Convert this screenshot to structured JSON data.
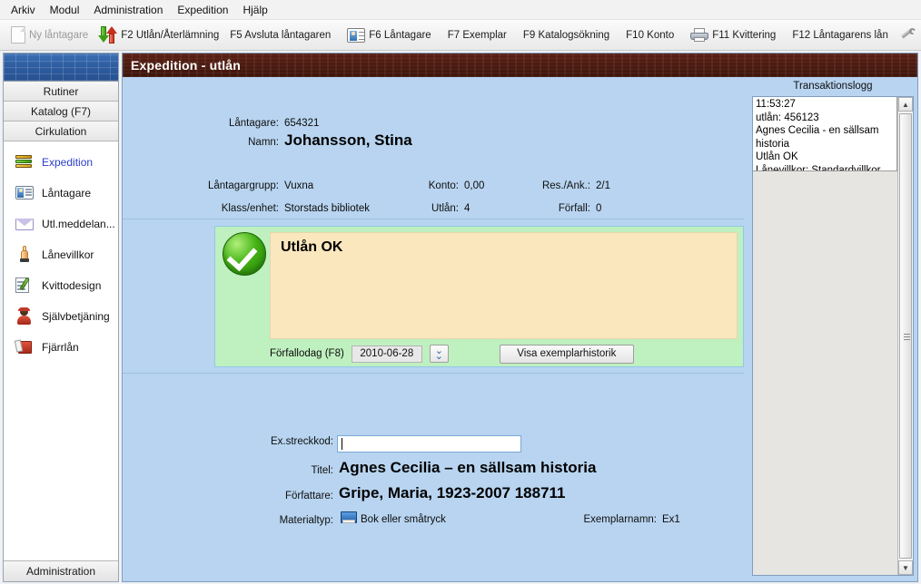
{
  "menubar": {
    "items": [
      {
        "label": "Arkiv"
      },
      {
        "label": "Modul"
      },
      {
        "label": "Administration"
      },
      {
        "label": "Expedition"
      },
      {
        "label": "Hjälp"
      }
    ]
  },
  "toolbar": {
    "new_borrower": "Ny låntagare",
    "f2_loan_return": "F2 Utlån/Återlämning",
    "f5_end_borrower": "F5 Avsluta låntagaren",
    "f6_borrower": "F6 Låntagare",
    "f7_item": "F7 Exemplar",
    "f9_catalog_search": "F9 Katalogsökning",
    "f10_account": "F10 Konto",
    "f11_receipt": "F11 Kvittering",
    "f12_borrower_loans": "F12 Låntagarens lån",
    "help_glyph": "?"
  },
  "sidebar": {
    "groups": [
      {
        "label": "Rutiner"
      },
      {
        "label": "Katalog (F7)"
      },
      {
        "label": "Cirkulation"
      }
    ],
    "items": [
      {
        "label": "Expedition",
        "icon": "books-icon",
        "active": true
      },
      {
        "label": "Låntagare",
        "icon": "borrower-card-icon",
        "active": false
      },
      {
        "label": "Utl.meddelan...",
        "icon": "envelope-icon",
        "active": false
      },
      {
        "label": "Lånevillkor",
        "icon": "pointing-hand-icon",
        "active": false
      },
      {
        "label": "Kvittodesign",
        "icon": "receipt-pencil-icon",
        "active": false
      },
      {
        "label": "Självbetjäning",
        "icon": "self-service-person-icon",
        "active": false
      },
      {
        "label": "Fjärrlån",
        "icon": "interlibrary-loan-icon",
        "active": false
      }
    ],
    "footer": "Administration"
  },
  "panel": {
    "title": "Expedition - utlån"
  },
  "borrower": {
    "id_label": "Låntagare:",
    "id_value": "654321",
    "name_label": "Namn:",
    "name_value": "Johansson, Stina",
    "group_label": "Låntagargrupp:",
    "group_value": "Vuxna",
    "class_label": "Klass/enhet:",
    "class_value": "Storstads bibliotek",
    "account_label": "Konto:",
    "account_value": "0,00",
    "loans_label": "Utlån:",
    "loans_value": "4",
    "reservations_label": "Res./Ank.:",
    "reservations_value": "2/1",
    "overdue_label": "Förfall:",
    "overdue_value": "0"
  },
  "status": {
    "icon": "green-check-icon",
    "message_title": "Utlån OK",
    "due_label": "Förfallodag (F8)",
    "due_date": "2010-06-28",
    "spin_glyph": "⌄",
    "history_button": "Visa exemplarhistorik"
  },
  "item": {
    "barcode_label": "Ex.streckkod:",
    "barcode_value": "",
    "title_label": "Titel:",
    "title_value": "Agnes Cecilia – en sällsam historia",
    "author_label": "Författare:",
    "author_value": "Gripe, Maria, 1923-2007 188711",
    "material_label": "Materialtyp:",
    "material_value": "Bok eller småtryck",
    "material_icon": "blue-book-icon",
    "copy_label": "Exemplarnamn:",
    "copy_value": "Ex1"
  },
  "translog": {
    "title": "Transaktionslogg",
    "lines": [
      "11:53:27",
      "utlån: 456123",
      "Agnes Cecilia - en sällsam",
      "historia",
      "Utlån OK",
      "Lånevillkor: Standardvillkor"
    ],
    "scroll_up_glyph": "▲",
    "scroll_down_glyph": "▼"
  },
  "colors": {
    "panel_background": "#b8d4f0",
    "title_bar": "#4a1a10",
    "status_green": "#bff0bf",
    "message_cream": "#fbe7bd",
    "accent_link": "#2a3ec8",
    "sidebar_banner": "#2f5fa3"
  }
}
